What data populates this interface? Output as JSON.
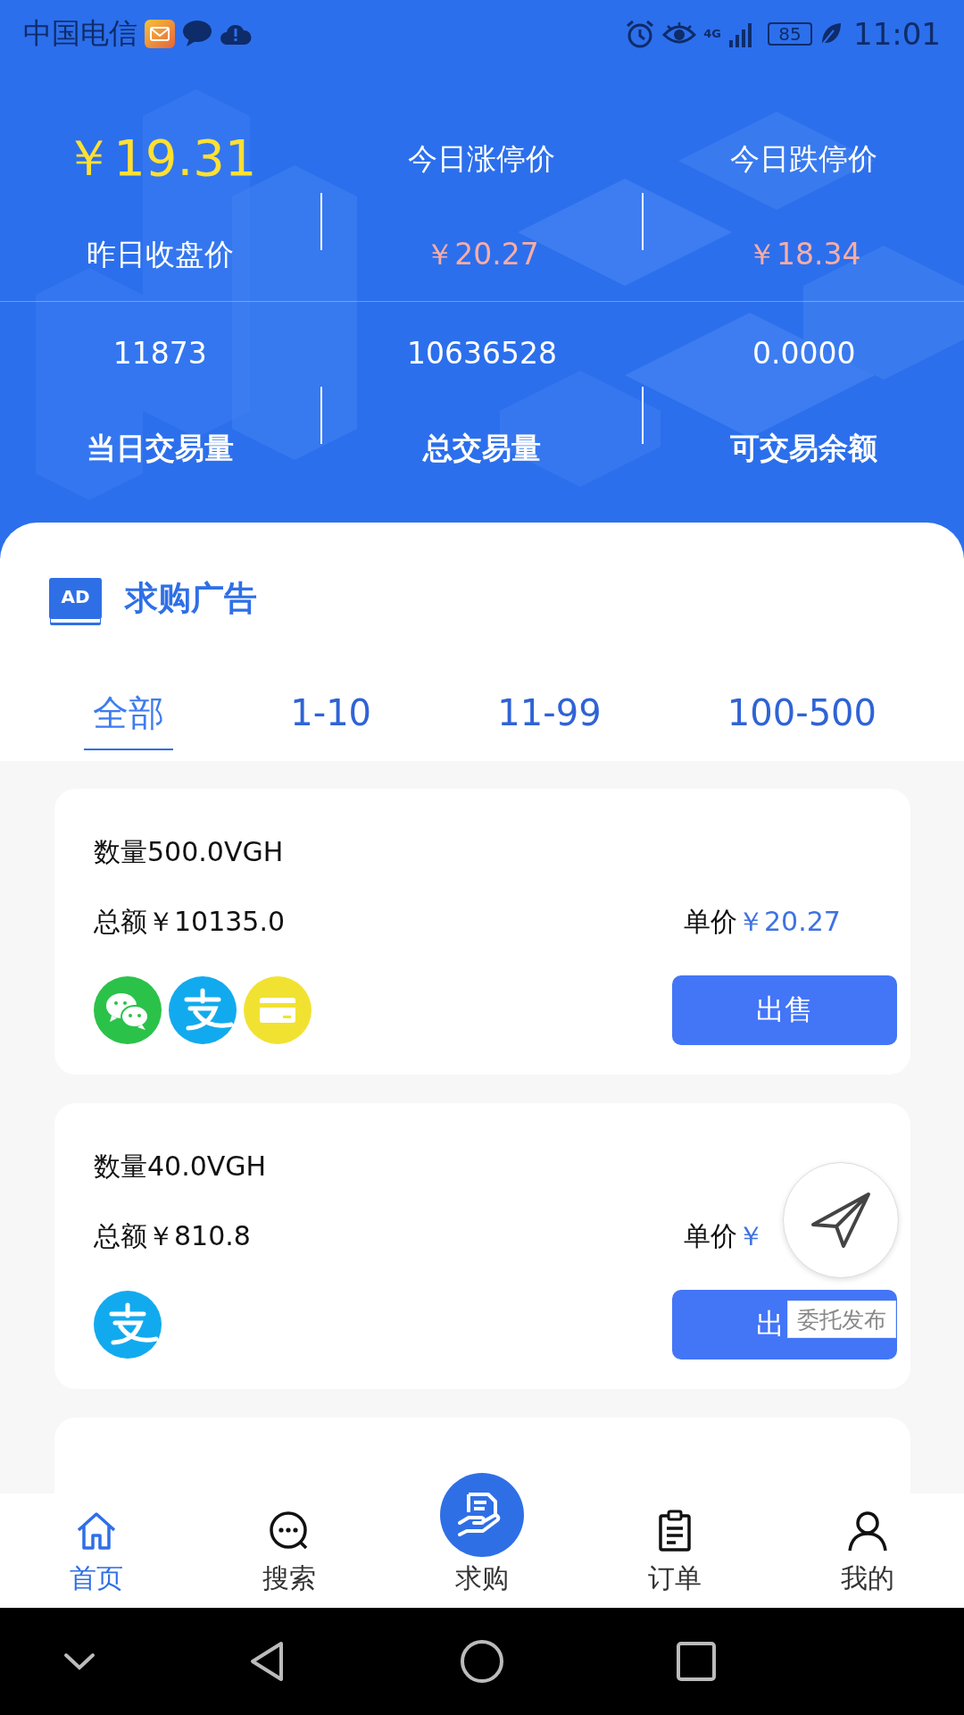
{
  "status_bar": {
    "carrier": "中国电信",
    "network": "4G",
    "battery": "85",
    "time": "11:01"
  },
  "price_stats": [
    {
      "kind": "close",
      "top": "￥19.31",
      "bottom": "昨日收盘价"
    },
    {
      "kind": "up",
      "top": "今日涨停价",
      "bottom": "￥20.27"
    },
    {
      "kind": "down",
      "top": "今日跌停价",
      "bottom": "￥18.34"
    }
  ],
  "volume_stats": [
    {
      "value": "11873",
      "label": "当日交易量"
    },
    {
      "value": "10636528",
      "label": "总交易量"
    },
    {
      "value": "0.0000",
      "label": "可交易余额"
    }
  ],
  "section": {
    "badge": "AD",
    "title": "求购广告"
  },
  "tabs": [
    {
      "label": "全部",
      "selected": true
    },
    {
      "label": "1-10",
      "selected": false
    },
    {
      "label": "11-99",
      "selected": false
    },
    {
      "label": "100-500",
      "selected": false
    }
  ],
  "ads": [
    {
      "quantity": "数量500.0VGH",
      "total": "总额￥10135.0",
      "price_label": "单价",
      "price": "￥20.27",
      "payments": [
        {
          "kind": "wechat"
        },
        {
          "kind": "alipay"
        },
        {
          "kind": "card"
        }
      ],
      "button": "出售"
    },
    {
      "quantity": "数量40.0VGH",
      "total": "总额￥810.8",
      "price_label": "单价",
      "price": "￥",
      "payments": [
        {
          "kind": "alipay"
        }
      ],
      "button": "出"
    }
  ],
  "float_button": {
    "label": "委托发布"
  },
  "bottom_nav": [
    {
      "kind": "home",
      "label": "首页",
      "selected": true
    },
    {
      "kind": "search",
      "label": "搜索",
      "selected": false
    },
    {
      "kind": "buy",
      "label": "求购",
      "selected": false
    },
    {
      "kind": "order",
      "label": "订单",
      "selected": false
    },
    {
      "kind": "me",
      "label": "我的",
      "selected": false
    }
  ]
}
